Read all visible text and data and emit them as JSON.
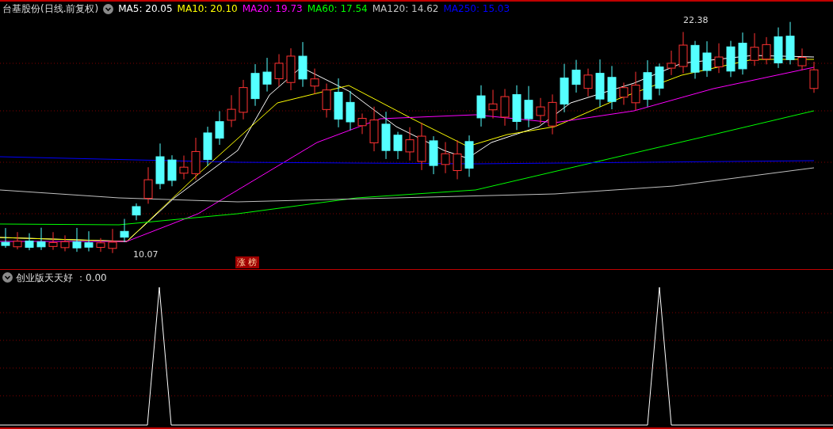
{
  "header": {
    "title": "台基股份(日线.前复权)",
    "ma": [
      {
        "label": "MA5: 20.05",
        "color": "#ffffff"
      },
      {
        "label": "MA10: 20.10",
        "color": "#ffff00"
      },
      {
        "label": "MA20: 19.73",
        "color": "#ff00ff"
      },
      {
        "label": "MA60: 17.54",
        "color": "#00ff00"
      },
      {
        "label": "MA120: 14.62",
        "color": "#c0c0c0"
      },
      {
        "label": "MA250: 15.03",
        "color": "#0000ff"
      }
    ]
  },
  "chart": {
    "high_label": "22.38",
    "low_label": "10.07",
    "badge": "涨 榜"
  },
  "indicator": {
    "name": "创业版天天好",
    "value": "：0.00"
  }
}
